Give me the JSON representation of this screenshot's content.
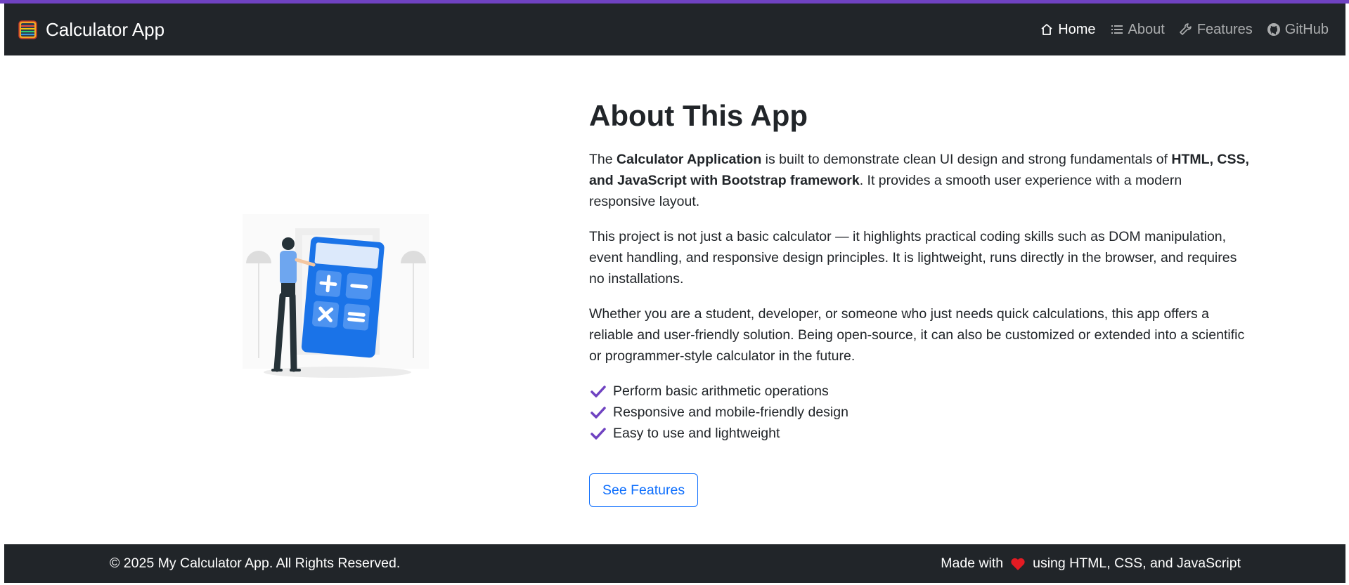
{
  "navbar": {
    "brand": "Calculator App",
    "links": [
      {
        "label": "Home",
        "icon": "house-icon",
        "active": true
      },
      {
        "label": "About",
        "icon": "list-icon",
        "active": false
      },
      {
        "label": "Features",
        "icon": "wrench-icon",
        "active": false
      },
      {
        "label": "GitHub",
        "icon": "github-icon",
        "active": false
      }
    ]
  },
  "about": {
    "title": "About This App",
    "p1": {
      "t1": "The ",
      "b1": "Calculator Application",
      "t2": " is built to demonstrate clean UI design and strong fundamentals of ",
      "b2": "HTML, CSS, and JavaScript with Bootstrap framework",
      "t3": ". It provides a smooth user experience with a modern responsive layout."
    },
    "p2": "This project is not just a basic calculator — it highlights practical coding skills such as DOM manipulation, event handling, and responsive design principles. It is lightweight, runs directly in the browser, and requires no installations.",
    "p3": "Whether you are a student, developer, or someone who just needs quick calculations, this app offers a reliable and user-friendly solution. Being open-source, it can also be customized or extended into a scientific or programmer-style calculator in the future.",
    "features": [
      "Perform basic arithmetic operations",
      "Responsive and mobile-friendly design",
      "Easy to use and lightweight"
    ],
    "button": "See Features"
  },
  "footer": {
    "copyright": "© 2025 My Calculator App. All Rights Reserved.",
    "made_with_prefix": "Made with",
    "made_with_suffix": "using HTML, CSS, and JavaScript"
  },
  "colors": {
    "navbar_bg": "#212529",
    "accent": "#6f42c1",
    "button": "#0d6efd",
    "check": "#6f42c1",
    "heart": "#e31b23",
    "illustration_blue": "#1a73e8"
  }
}
